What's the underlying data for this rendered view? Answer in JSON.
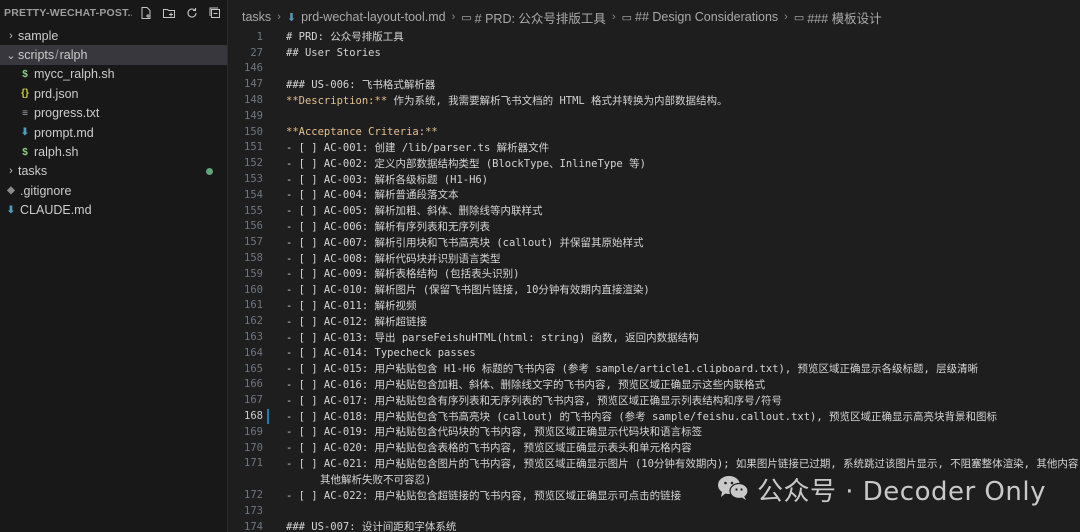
{
  "sidebar": {
    "title": "PRETTY-WECHAT-POST...",
    "items": [
      {
        "label": "sample",
        "kind": "folder",
        "expanded": false
      },
      {
        "label_parts": [
          "scripts",
          "ralph"
        ],
        "kind": "folder",
        "expanded": true
      },
      {
        "label": "mycc_ralph.sh",
        "kind": "shell"
      },
      {
        "label": "prd.json",
        "kind": "json"
      },
      {
        "label": "progress.txt",
        "kind": "text"
      },
      {
        "label": "prompt.md",
        "kind": "markdown"
      },
      {
        "label": "ralph.sh",
        "kind": "shell"
      },
      {
        "label": "tasks",
        "kind": "folder",
        "expanded": false,
        "modified": true
      },
      {
        "label": ".gitignore",
        "kind": "gitignore"
      },
      {
        "label": "CLAUDE.md",
        "kind": "markdown"
      }
    ],
    "separator": "/"
  },
  "breadcrumb": {
    "items": [
      "tasks",
      "prd-wechat-layout-tool.md",
      "# PRD: 公众号排版工具",
      "## Design Considerations",
      "### 模板设计"
    ]
  },
  "code": {
    "lines": [
      {
        "n": "1",
        "text": "# PRD: 公众号排版工具"
      },
      {
        "n": "27",
        "text": "## User Stories"
      },
      {
        "n": "146",
        "text": ""
      },
      {
        "n": "147",
        "text": "### US-006: 飞书格式解析器"
      },
      {
        "n": "148",
        "bold": "**Description:**",
        "text": " 作为系统, 我需要解析飞书文档的 HTML 格式并转换为内部数据结构。"
      },
      {
        "n": "149",
        "text": ""
      },
      {
        "n": "150",
        "bold": "**Acceptance Criteria:**",
        "text": ""
      },
      {
        "n": "151",
        "text": "- [ ] AC-001: 创建 /lib/parser.ts 解析器文件"
      },
      {
        "n": "152",
        "text": "- [ ] AC-002: 定义内部数据结构类型 (BlockType、InlineType 等)"
      },
      {
        "n": "153",
        "text": "- [ ] AC-003: 解析各级标题 (H1-H6)"
      },
      {
        "n": "154",
        "text": "- [ ] AC-004: 解析普通段落文本"
      },
      {
        "n": "155",
        "text": "- [ ] AC-005: 解析加粗、斜体、删除线等内联样式"
      },
      {
        "n": "156",
        "text": "- [ ] AC-006: 解析有序列表和无序列表"
      },
      {
        "n": "157",
        "text": "- [ ] AC-007: 解析引用块和飞书高亮块 (callout) 并保留其原始样式"
      },
      {
        "n": "158",
        "text": "- [ ] AC-008: 解析代码块并识别语言类型"
      },
      {
        "n": "159",
        "text": "- [ ] AC-009: 解析表格结构 (包括表头识别)"
      },
      {
        "n": "160",
        "text": "- [ ] AC-010: 解析图片 (保留飞书图片链接, 10分钟有效期内直接渲染)"
      },
      {
        "n": "161",
        "text": "- [ ] AC-011: 解析视频"
      },
      {
        "n": "162",
        "text": "- [ ] AC-012: 解析超链接"
      },
      {
        "n": "163",
        "text": "- [ ] AC-013: 导出 parseFeishuHTML(html: string) 函数, 返回内数据结构"
      },
      {
        "n": "164",
        "text": "- [ ] AC-014: Typecheck passes"
      },
      {
        "n": "165",
        "text": "- [ ] AC-015: 用户粘贴包含 H1-H6 标题的飞书内容 (参考 sample/article1.clipboard.txt), 预览区域正确显示各级标题, 层级清晰"
      },
      {
        "n": "166",
        "text": "- [ ] AC-016: 用户粘贴包含加粗、斜体、删除线文字的飞书内容, 预览区域正确显示这些内联格式"
      },
      {
        "n": "167",
        "text": "- [ ] AC-017: 用户粘贴包含有序列表和无序列表的飞书内容, 预览区域正确显示列表结构和序号/符号"
      },
      {
        "n": "168",
        "text": "- [ ] AC-018: 用户粘贴包含飞书高亮块 (callout) 的飞书内容 (参考 sample/feishu.callout.txt), 预览区域正确显示高亮块背景和图标",
        "current": true
      },
      {
        "n": "169",
        "text": "- [ ] AC-019: 用户粘贴包含代码块的飞书内容, 预览区域正确显示代码块和语言标签"
      },
      {
        "n": "170",
        "text": "- [ ] AC-020: 用户粘贴包含表格的飞书内容, 预览区域正确显示表头和单元格内容"
      },
      {
        "n": "171",
        "text": "- [ ] AC-021: 用户粘贴包含图片的飞书内容, 预览区域正确显示图片 (10分钟有效期内); 如果图片链接已过期, 系统跳过该图片显示, 不阻塞整体渲染, 其他内容"
      },
      {
        "n": "",
        "text": "其他解析失败不可容忍)"
      },
      {
        "n": "172",
        "text": "- [ ] AC-022: 用户粘贴包含超链接的飞书内容, 预览区域正确显示可点击的链接"
      },
      {
        "n": "173",
        "text": ""
      },
      {
        "n": "174",
        "text": "### US-007: 设计间距和字体系统"
      }
    ]
  },
  "watermark": {
    "text": "公众号 · Decoder Only"
  },
  "colors": {
    "accent_md": "#519aba",
    "bold": "#e2c08d",
    "modified_dot": "#73c991",
    "folder_chevron": "#c5c5c5"
  }
}
